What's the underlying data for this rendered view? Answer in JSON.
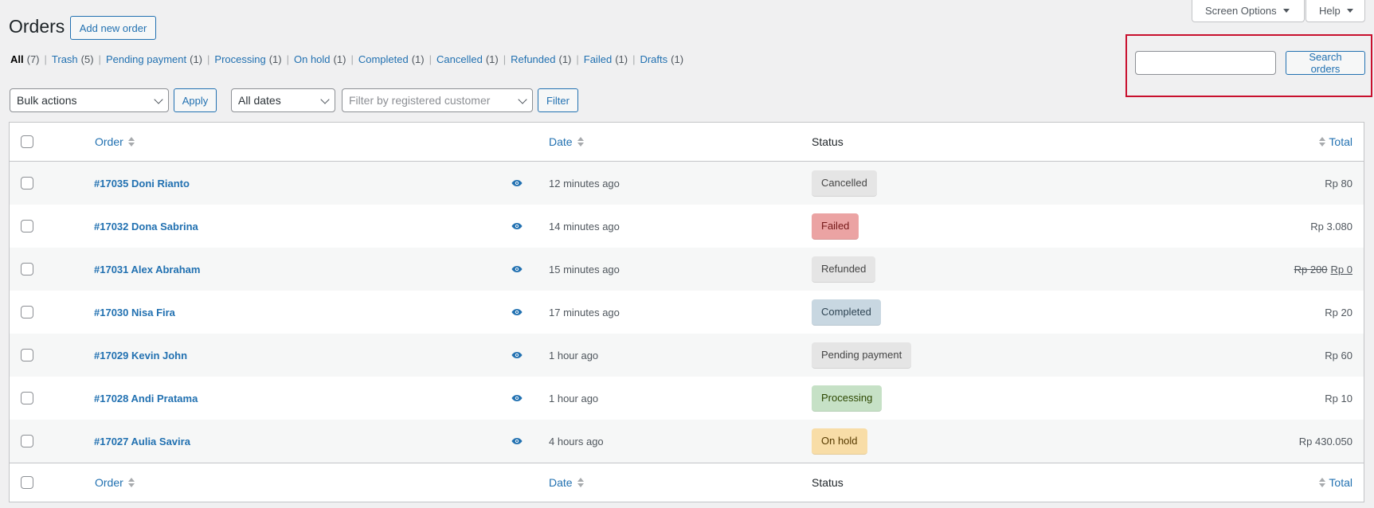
{
  "header": {
    "title": "Orders",
    "add_new": "Add new order",
    "screen_options": "Screen Options",
    "help": "Help"
  },
  "filters_links": [
    {
      "label": "All",
      "count": "(7)",
      "current": true
    },
    {
      "label": "Trash",
      "count": "(5)"
    },
    {
      "label": "Pending payment",
      "count": "(1)"
    },
    {
      "label": "Processing",
      "count": "(1)"
    },
    {
      "label": "On hold",
      "count": "(1)"
    },
    {
      "label": "Completed",
      "count": "(1)"
    },
    {
      "label": "Cancelled",
      "count": "(1)"
    },
    {
      "label": "Refunded",
      "count": "(1)"
    },
    {
      "label": "Failed",
      "count": "(1)"
    },
    {
      "label": "Drafts",
      "count": "(1)"
    }
  ],
  "search": {
    "value": "",
    "button": "Search orders"
  },
  "toolbar": {
    "bulk_actions": "Bulk actions",
    "apply": "Apply",
    "dates": "All dates",
    "customer_placeholder": "Filter by registered customer",
    "filter": "Filter"
  },
  "columns": {
    "order": "Order",
    "date": "Date",
    "status": "Status",
    "total": "Total"
  },
  "orders": [
    {
      "order": "#17035 Doni Rianto",
      "date": "12 minutes ago",
      "status": "Cancelled",
      "status_bg": "#e5e5e5",
      "status_fg": "#454545",
      "total": "Rp 80"
    },
    {
      "order": "#17032 Dona Sabrina",
      "date": "14 minutes ago",
      "status": "Failed",
      "status_bg": "#eba3a3",
      "status_fg": "#761919",
      "total": "Rp 3.080"
    },
    {
      "order": "#17031 Alex Abraham",
      "date": "15 minutes ago",
      "status": "Refunded",
      "status_bg": "#e5e5e5",
      "status_fg": "#454545",
      "total_old": "Rp 200",
      "total": "Rp 0"
    },
    {
      "order": "#17030 Nisa Fira",
      "date": "17 minutes ago",
      "status": "Completed",
      "status_bg": "#c8d7e1",
      "status_fg": "#2e4453",
      "total": "Rp 20"
    },
    {
      "order": "#17029 Kevin John",
      "date": "1 hour ago",
      "status": "Pending payment",
      "status_bg": "#e5e5e5",
      "status_fg": "#454545",
      "total": "Rp 60"
    },
    {
      "order": "#17028 Andi Pratama",
      "date": "1 hour ago",
      "status": "Processing",
      "status_bg": "#c6e1c6",
      "status_fg": "#2c4700",
      "total": "Rp 10"
    },
    {
      "order": "#17027 Aulia Savira",
      "date": "4 hours ago",
      "status": "On hold",
      "status_bg": "#f8dda7",
      "status_fg": "#573b00",
      "total": "Rp 430.050"
    }
  ],
  "icons": {
    "preview": "eye-icon",
    "sort": "sort-arrows-icon",
    "dropdown": "chevron-down-icon"
  },
  "colors": {
    "accent": "#2271b1",
    "highlight_box": "#c8102e",
    "background": "#f0f0f1"
  }
}
